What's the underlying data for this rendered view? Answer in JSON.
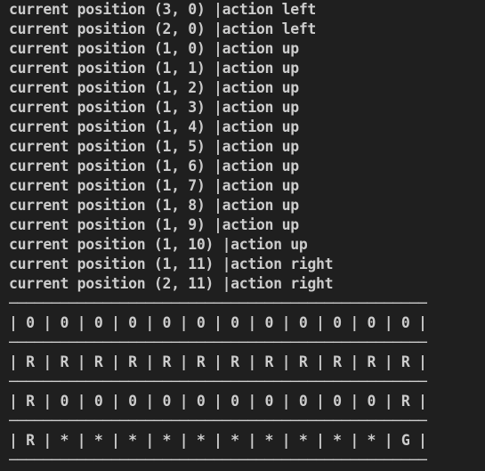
{
  "terminal": {
    "log_lines": [
      "current position (3, 0) |action left",
      "current position (2, 0) |action left",
      "current position (1, 0) |action up",
      "current position (1, 1) |action up",
      "current position (1, 2) |action up",
      "current position (1, 3) |action up",
      "current position (1, 4) |action up",
      "current position (1, 5) |action up",
      "current position (1, 6) |action up",
      "current position (1, 7) |action up",
      "current position (1, 8) |action up",
      "current position (1, 9) |action up",
      "current position (1, 10) |action up",
      "current position (1, 11) |action right",
      "current position (2, 11) |action right"
    ],
    "grid_lines": [
      "─────────────────────────────────────────────────",
      "| 0 | 0 | 0 | 0 | 0 | 0 | 0 | 0 | 0 | 0 | 0 | 0 |",
      "─────────────────────────────────────────────────",
      "| R | R | R | R | R | R | R | R | R | R | R | R |",
      "─────────────────────────────────────────────────",
      "| R | 0 | 0 | 0 | 0 | 0 | 0 | 0 | 0 | 0 | 0 | R |",
      "─────────────────────────────────────────────────",
      "| R | * | * | * | * | * | * | * | * | * | * | G |",
      "─────────────────────────────────────────────────"
    ]
  }
}
